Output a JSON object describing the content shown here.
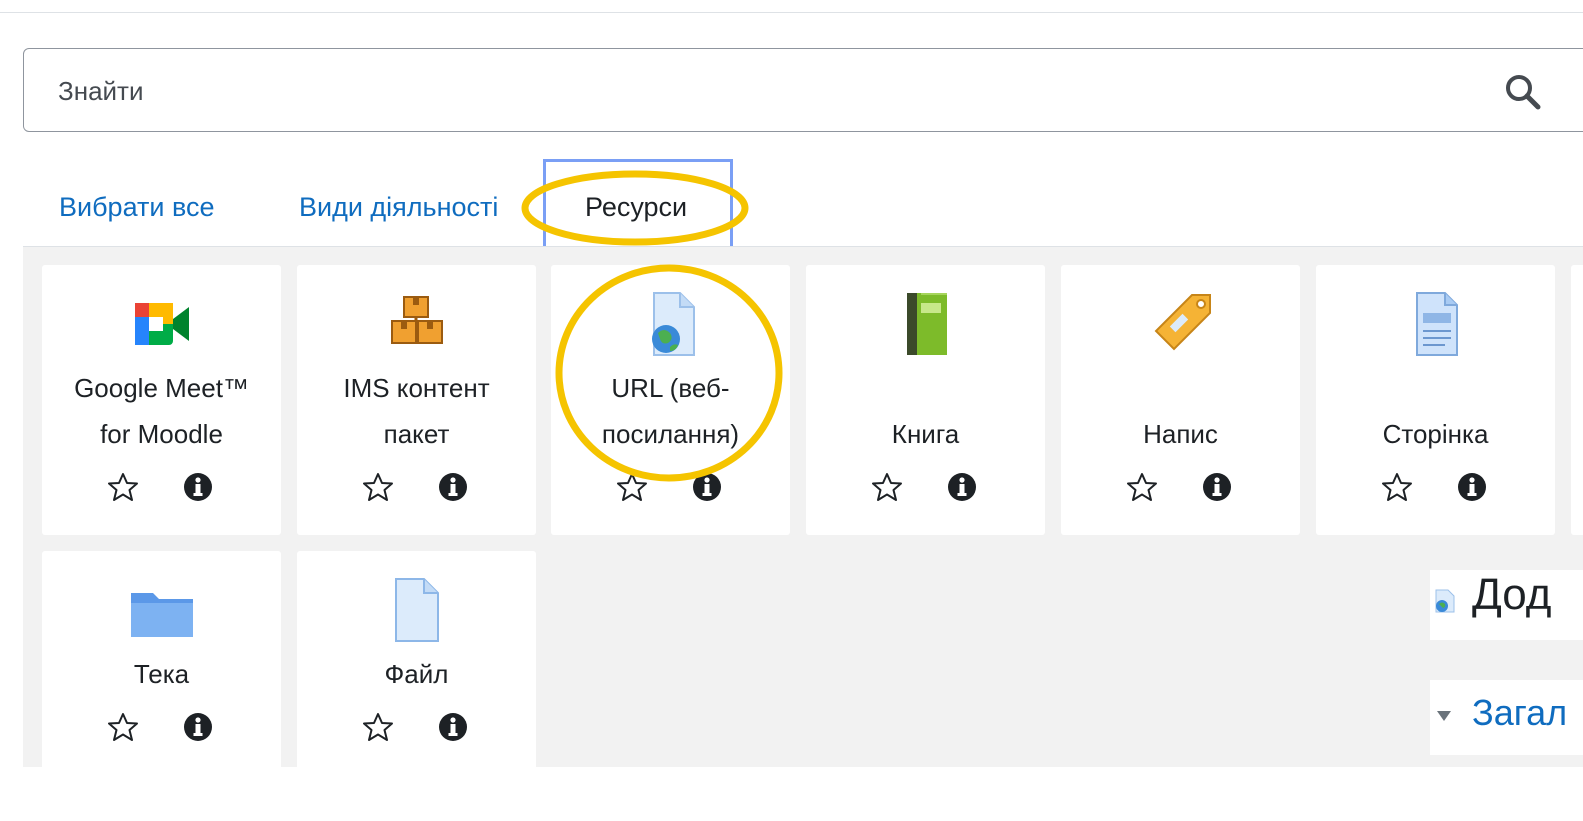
{
  "search": {
    "placeholder": "Знайти",
    "value": ""
  },
  "tabs": [
    {
      "label": "Вибрати все"
    },
    {
      "label": "Види діяльності"
    },
    {
      "label": "Ресурси",
      "active": true
    }
  ],
  "modules": [
    {
      "line1": "Google Meet™",
      "line2": "for Moodle",
      "icon": "google-meet-icon"
    },
    {
      "line1": "IMS контент",
      "line2": "пакет",
      "icon": "ims-package-icon"
    },
    {
      "line1": "URL (веб-",
      "line2": "посилання)",
      "icon": "url-globe-icon"
    },
    {
      "line1": "Книга",
      "icon": "book-icon"
    },
    {
      "line1": "Напис",
      "icon": "label-tag-icon"
    },
    {
      "line1": "Сторінка",
      "icon": "page-icon"
    },
    {
      "line1": "Тека",
      "icon": "folder-icon"
    },
    {
      "line1": "Файл",
      "icon": "file-icon"
    }
  ],
  "side": {
    "heading": "Дод",
    "section": "Загал"
  },
  "colors": {
    "link": "#0f6cbf",
    "highlight": "#f5c400",
    "tab_frame": "#7a9ff5",
    "panel": "#f2f2f2"
  }
}
